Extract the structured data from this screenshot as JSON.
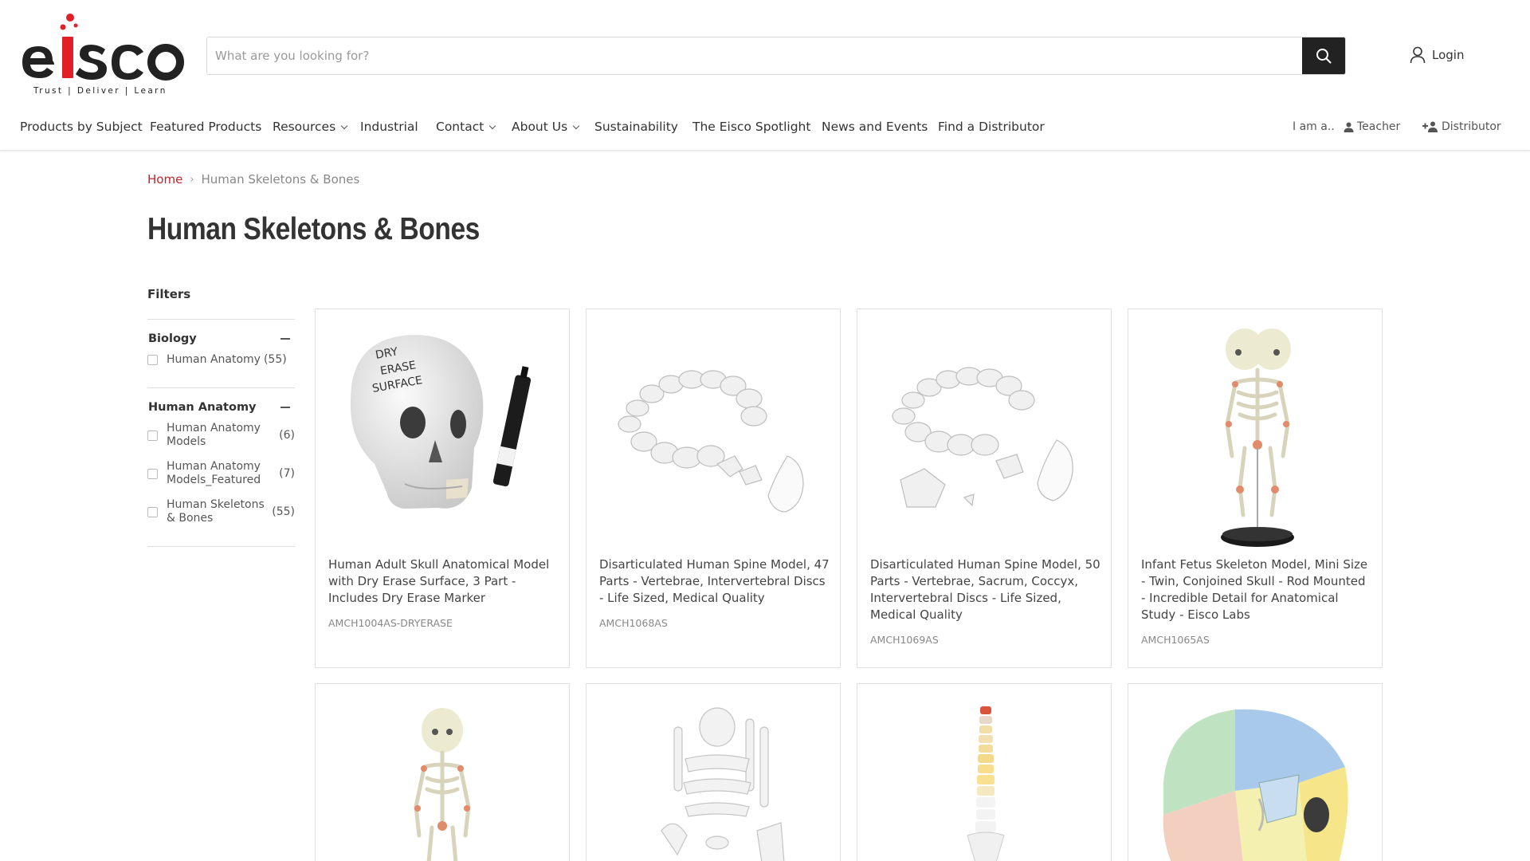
{
  "logo": {
    "name": "eisco",
    "tagline": "Trust | Deliver | Learn",
    "accent": "#e01f26"
  },
  "search": {
    "placeholder": "What are you looking for?",
    "icon": "search-icon"
  },
  "account": {
    "login_label": "Login",
    "icon": "user-icon"
  },
  "nav": {
    "items": [
      {
        "label": "Products by Subject",
        "dropdown": false
      },
      {
        "label": "Featured Products",
        "dropdown": false
      },
      {
        "label": "Resources",
        "dropdown": true
      },
      {
        "label": "Industrial",
        "dropdown": false
      },
      {
        "label": "Contact",
        "dropdown": true
      },
      {
        "label": "About Us",
        "dropdown": true
      },
      {
        "label": "Sustainability",
        "dropdown": false
      },
      {
        "label": "The Eisco Spotlight",
        "dropdown": false
      },
      {
        "label": "News and Events",
        "dropdown": false
      },
      {
        "label": "Find a Distributor",
        "dropdown": false
      }
    ],
    "iam_label": "I am a..",
    "teacher_label": "Teacher",
    "distributor_label": "Distributor"
  },
  "breadcrumb": {
    "home": "Home",
    "current": "Human Skeletons & Bones"
  },
  "page_title": "Human Skeletons & Bones",
  "filters": {
    "title": "Filters",
    "groups": [
      {
        "title": "Biology",
        "options": [
          {
            "label": "Human Anatomy",
            "count": "(55)"
          }
        ]
      },
      {
        "title": "Human Anatomy",
        "options": [
          {
            "label": "Human Anatomy Models",
            "count": "(6)"
          },
          {
            "label": "Human Anatomy Models_Featured",
            "count": "(7)"
          },
          {
            "label": "Human Skeletons & Bones",
            "count": "(55)"
          }
        ]
      }
    ]
  },
  "products": [
    {
      "name": "Human Adult Skull Anatomical Model with Dry Erase Surface, 3 Part - Includes Dry Erase Marker",
      "sku": "AMCH1004AS-DRYERASE",
      "image_text": "DRY ERASE SURFACE"
    },
    {
      "name": "Disarticulated Human Spine Model, 47 Parts - Vertebrae, Intervertebral Discs - Life Sized, Medical Quality",
      "sku": "AMCH1068AS"
    },
    {
      "name": "Disarticulated Human Spine Model, 50 Parts - Vertebrae, Sacrum, Coccyx, Intervertebral Discs - Life Sized, Medical Quality",
      "sku": "AMCH1069AS"
    },
    {
      "name": "Infant Fetus Skeleton Model, Mini Size - Twin, Conjoined Skull - Rod Mounted - Incredible Detail for Anatomical Study - Eisco Labs",
      "sku": "AMCH1065AS"
    }
  ],
  "colors": {
    "brand_red": "#c8202a",
    "dark": "#222222"
  }
}
